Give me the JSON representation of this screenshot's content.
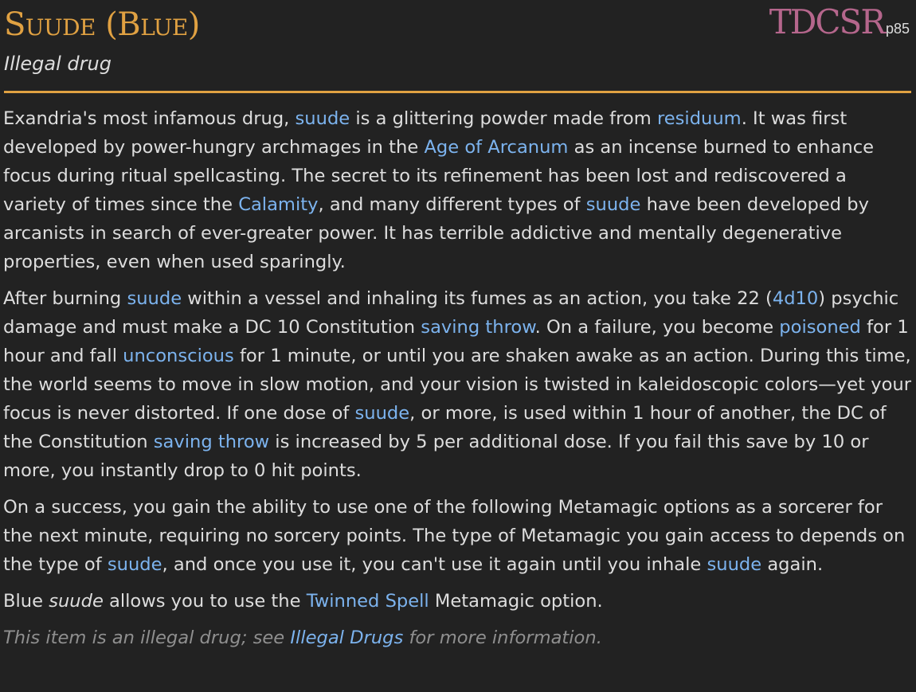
{
  "header": {
    "title": "Suude (Blue)",
    "source": "TDCSR",
    "page": "p85",
    "subtitle": "Illegal drug"
  },
  "colors": {
    "background": "#222222",
    "title": "#e0a142",
    "source": "#b5668c",
    "link": "#7cb3ee",
    "text": "#dddddd",
    "note": "#8f8f8f"
  },
  "p1": {
    "t1": "Exandria's most infamous drug, ",
    "l1": "suude",
    "t2": " is a glittering powder made from ",
    "l2": "residuum",
    "t3": ". It was first developed by power-hungry archmages in the ",
    "l3": "Age of Arcanum",
    "t4": " as an incense burned to enhance focus during ritual spellcasting. The secret to its refinement has been lost and rediscovered a variety of times since the ",
    "l4": "Calamity",
    "t5": ", and many different types of ",
    "l5": "suude",
    "t6": " have been developed by arcanists in search of ever-greater power. It has terrible addictive and mentally degenerative properties, even when used sparingly."
  },
  "p2": {
    "t1": "After burning ",
    "l1": "suude",
    "t2": " within a vessel and inhaling its fumes as an action, you take 22 (",
    "l2": "4d10",
    "t3": ") psychic damage and must make a DC 10 Constitution ",
    "l3": "saving throw",
    "t4": ". On a failure, you become ",
    "l4": "poisoned",
    "t5": " for 1 hour and fall ",
    "l5": "unconscious",
    "t6": " for 1 minute, or until you are shaken awake as an action. During this time, the world seems to move in slow motion, and your vision is twisted in kaleidoscopic colors—yet your focus is never distorted. If one dose of ",
    "l6": "suude",
    "t7": ", or more, is used within 1 hour of another, the DC of the Constitution ",
    "l7": "saving throw",
    "t8": " is increased by 5 per additional dose. If you fail this save by 10 or more, you instantly drop to 0 hit points."
  },
  "p3": {
    "t1": "On a success, you gain the ability to use one of the following Metamagic options as a sorcerer for the next minute, requiring no sorcery points. The type of Metamagic you gain access to depends on the type of ",
    "l1": "suude",
    "t2": ", and once you use it, you can't use it again until you inhale ",
    "l2": "suude",
    "t3": " again."
  },
  "p4": {
    "t1": "Blue ",
    "e1": "suude",
    "t2": " allows you to use the ",
    "l1": "Twinned Spell",
    "t3": " Metamagic option."
  },
  "note": {
    "t1": "This item is an illegal drug; see ",
    "l1": "Illegal Drugs",
    "t2": " for more information."
  }
}
